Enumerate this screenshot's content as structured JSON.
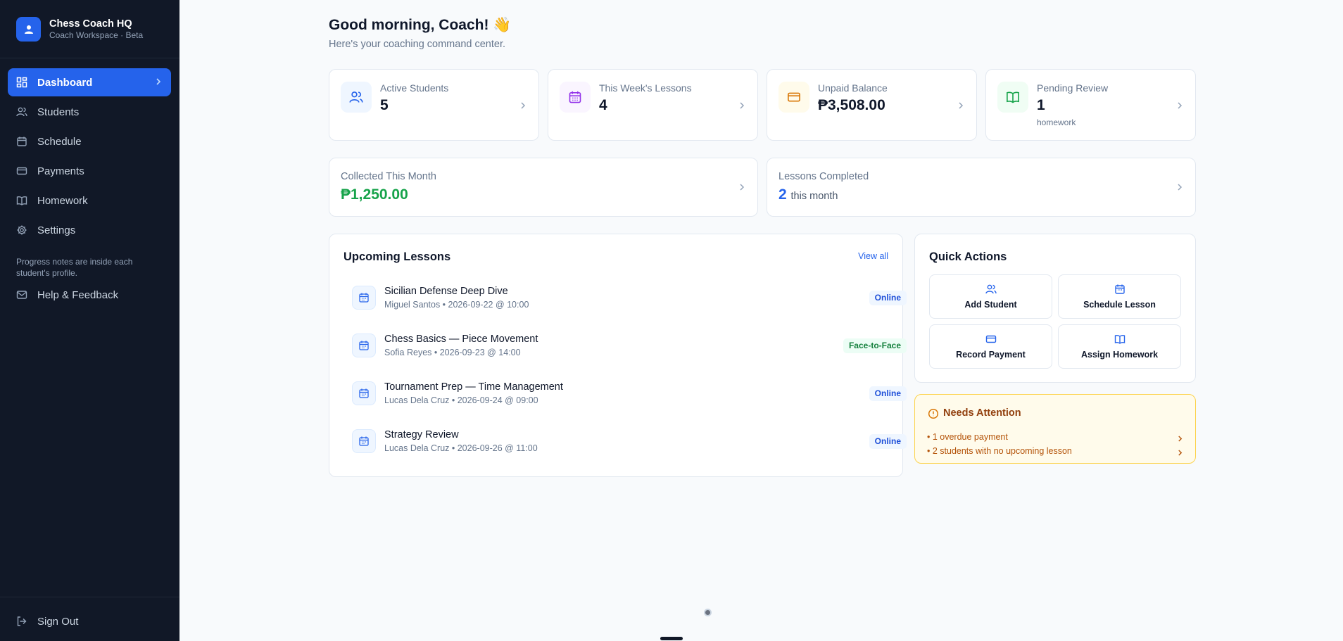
{
  "sidebar": {
    "brand_title": "Chess Coach HQ",
    "brand_subtitle": "Coach Workspace · Beta",
    "nav": [
      {
        "label": "Dashboard",
        "icon": "dashboard-icon",
        "active": true
      },
      {
        "label": "Students",
        "icon": "users-icon"
      },
      {
        "label": "Schedule",
        "icon": "calendar-icon"
      },
      {
        "label": "Payments",
        "icon": "credit-card-icon"
      },
      {
        "label": "Homework",
        "icon": "book-icon"
      },
      {
        "label": "Settings",
        "icon": "gear-icon"
      }
    ],
    "note": "Progress notes are inside each student's profile.",
    "help_label": "Help & Feedback",
    "signout_label": "Sign Out"
  },
  "header": {
    "greeting": "Good morning, Coach! 👋",
    "subtitle": "Here's your coaching command center."
  },
  "stats": [
    {
      "label": "Active Students",
      "value": "5",
      "sub": "",
      "icon": "users-icon",
      "color": "#2563eb",
      "bg": "#eff6ff"
    },
    {
      "label": "This Week's Lessons",
      "value": "4",
      "sub": "",
      "icon": "calendar-icon",
      "color": "#9333ea",
      "bg": "#faf5ff"
    },
    {
      "label": "Unpaid Balance",
      "value": "₱3,508.00",
      "sub": "",
      "icon": "credit-card-icon",
      "color": "#d97706",
      "bg": "#fffbeb"
    },
    {
      "label": "Pending Review",
      "value": "1",
      "sub": "homework",
      "icon": "book-icon",
      "color": "#16a34a",
      "bg": "#f0fdf4"
    }
  ],
  "collected": {
    "label": "Collected This Month",
    "value": "₱1,250.00",
    "color": "#16a34a"
  },
  "completed": {
    "label": "Lessons Completed",
    "value": "2",
    "suffix": "this month",
    "color": "#2563eb"
  },
  "upcoming": {
    "title": "Upcoming Lessons",
    "view_all": "View all",
    "lessons": [
      {
        "title": "Sicilian Defense Deep Dive",
        "meta": "Miguel Santos • 2026-09-22 @ 10:00",
        "badge": "Online"
      },
      {
        "title": "Chess Basics — Piece Movement",
        "meta": "Sofia Reyes • 2026-09-23 @ 14:00",
        "badge": "Face-to-Face"
      },
      {
        "title": "Tournament Prep — Time Management",
        "meta": "Lucas Dela Cruz • 2026-09-24 @ 09:00",
        "badge": "Online"
      },
      {
        "title": "Strategy Review",
        "meta": "Lucas Dela Cruz • 2026-09-26 @ 11:00",
        "badge": "Online"
      }
    ]
  },
  "quick_actions": {
    "title": "Quick Actions",
    "actions": [
      {
        "label": "Add Student",
        "icon": "users-icon"
      },
      {
        "label": "Schedule Lesson",
        "icon": "calendar-icon"
      },
      {
        "label": "Record Payment",
        "icon": "credit-card-icon"
      },
      {
        "label": "Assign Homework",
        "icon": "book-icon"
      }
    ]
  },
  "attention": {
    "title": "Needs Attention",
    "items": [
      "• 1 overdue payment",
      "• 2 students with no upcoming lesson"
    ]
  }
}
